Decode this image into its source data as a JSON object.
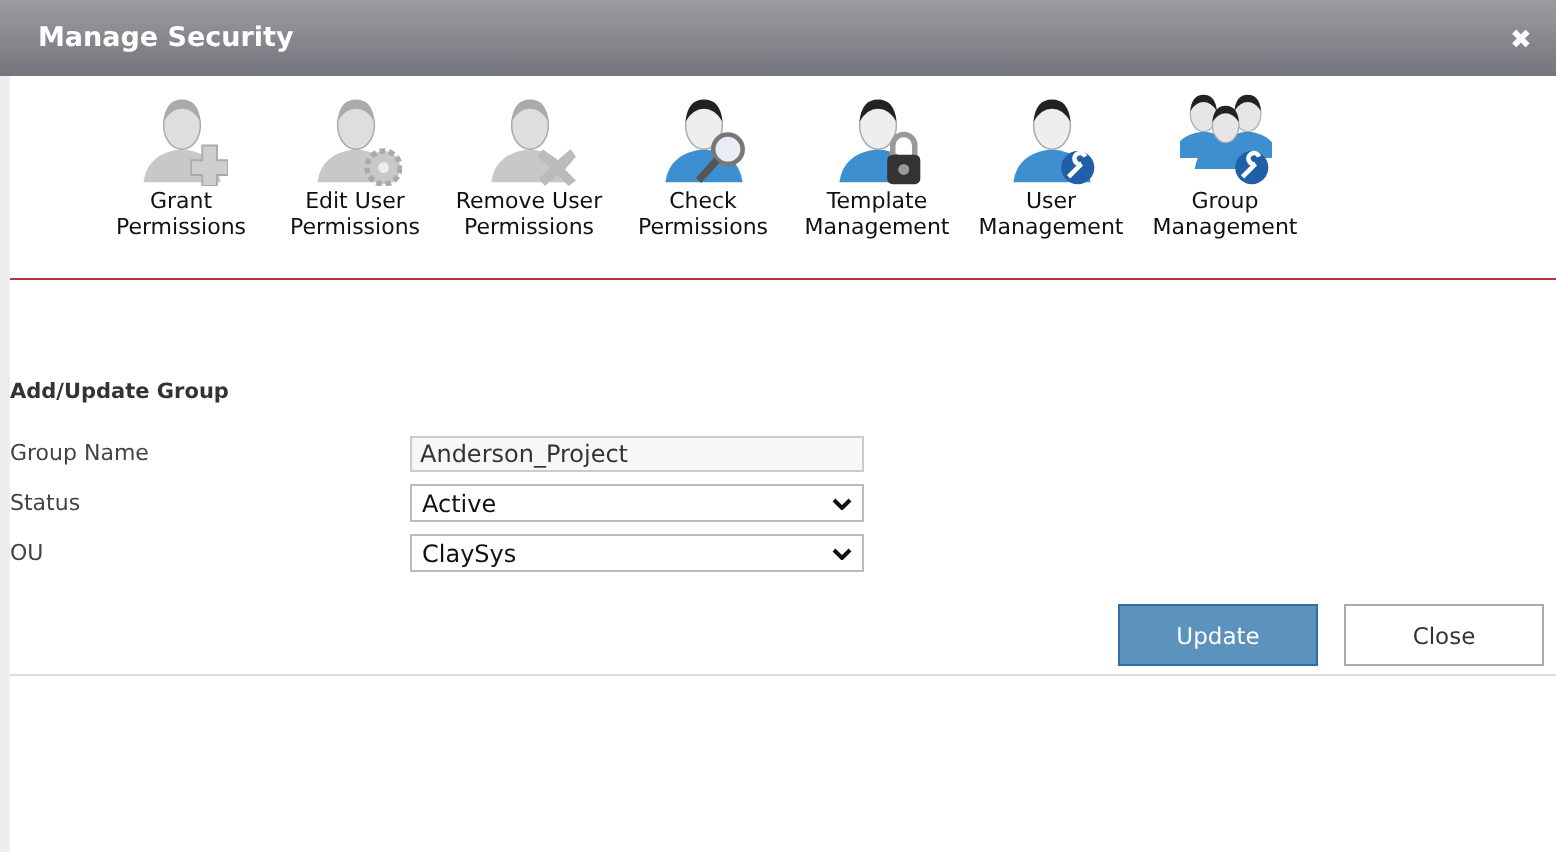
{
  "window": {
    "title": "Manage Security",
    "close": "✖"
  },
  "toolbar": [
    {
      "label": "Grant Permissions",
      "kind": "plus",
      "disabled": true
    },
    {
      "label": "Edit User Permissions",
      "kind": "gear",
      "disabled": true
    },
    {
      "label": "Remove User Permissions",
      "kind": "cross",
      "disabled": true
    },
    {
      "label": "Check Permissions",
      "kind": "magnifier",
      "disabled": false
    },
    {
      "label": "Template Management",
      "kind": "lock",
      "disabled": false
    },
    {
      "label": "User Management",
      "kind": "wrench",
      "disabled": false
    },
    {
      "label": "Group Management",
      "kind": "group",
      "disabled": false
    }
  ],
  "form": {
    "title": "Add/Update Group",
    "fields": [
      {
        "label": "Group Name",
        "kind": "text",
        "value": "Anderson_Project"
      },
      {
        "label": "Status",
        "kind": "select",
        "value": "Active"
      },
      {
        "label": "OU",
        "kind": "select",
        "value": "ClaySys"
      }
    ]
  },
  "buttons": [
    {
      "label": "Update",
      "kind": "primary"
    },
    {
      "label": "Close",
      "kind": "secondary"
    }
  ]
}
